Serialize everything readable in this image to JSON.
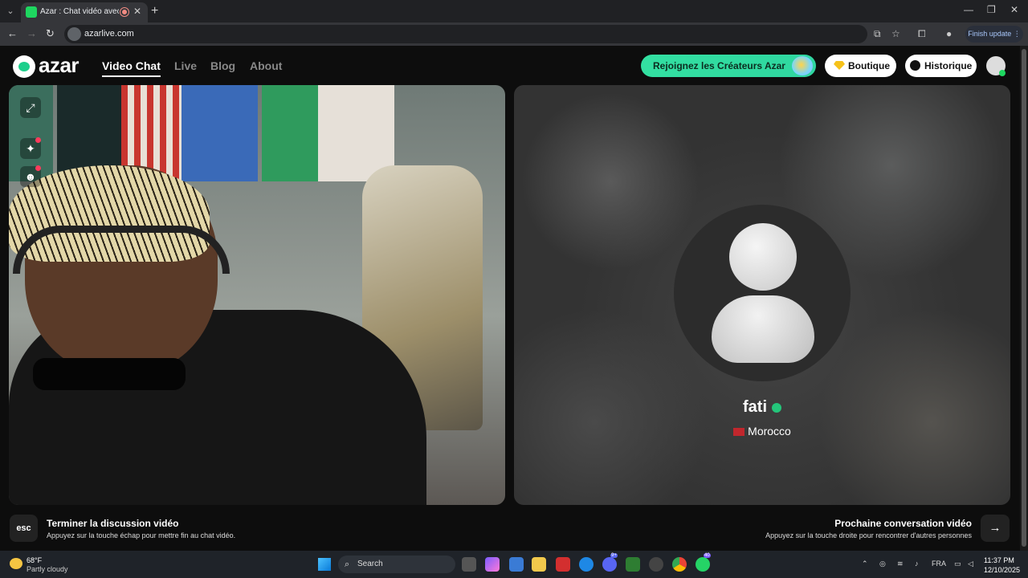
{
  "browser": {
    "tab_title": "Azar : Chat vidéo avec de n",
    "url": "azarlive.com",
    "finish_update": "Finish update"
  },
  "site": {
    "logo": "azar",
    "nav": [
      "Video Chat",
      "Live",
      "Blog",
      "About"
    ],
    "creators_button": "Rejoignez les Créateurs Azar",
    "boutique_button": "Boutique",
    "history_button": "Historique"
  },
  "partner": {
    "name": "fati",
    "country": "Morocco"
  },
  "footer": {
    "esc_key": "esc",
    "end_title": "Terminer la discussion vidéo",
    "end_sub": "Appuyez sur la touche échap pour mettre fin au chat vidéo.",
    "next_title": "Prochaine conversation vidéo",
    "next_sub": "Appuyez sur la touche droite pour rencontrer d'autres personnes",
    "next_icon": "arrow-right-icon"
  },
  "taskbar": {
    "temperature": "68°F",
    "condition": "Partly cloudy",
    "search_label": "Search",
    "language": "FRA",
    "time": "11:37 PM",
    "date": "12/10/2025",
    "badge_discord": "9+",
    "badge_whatsapp": "40"
  }
}
